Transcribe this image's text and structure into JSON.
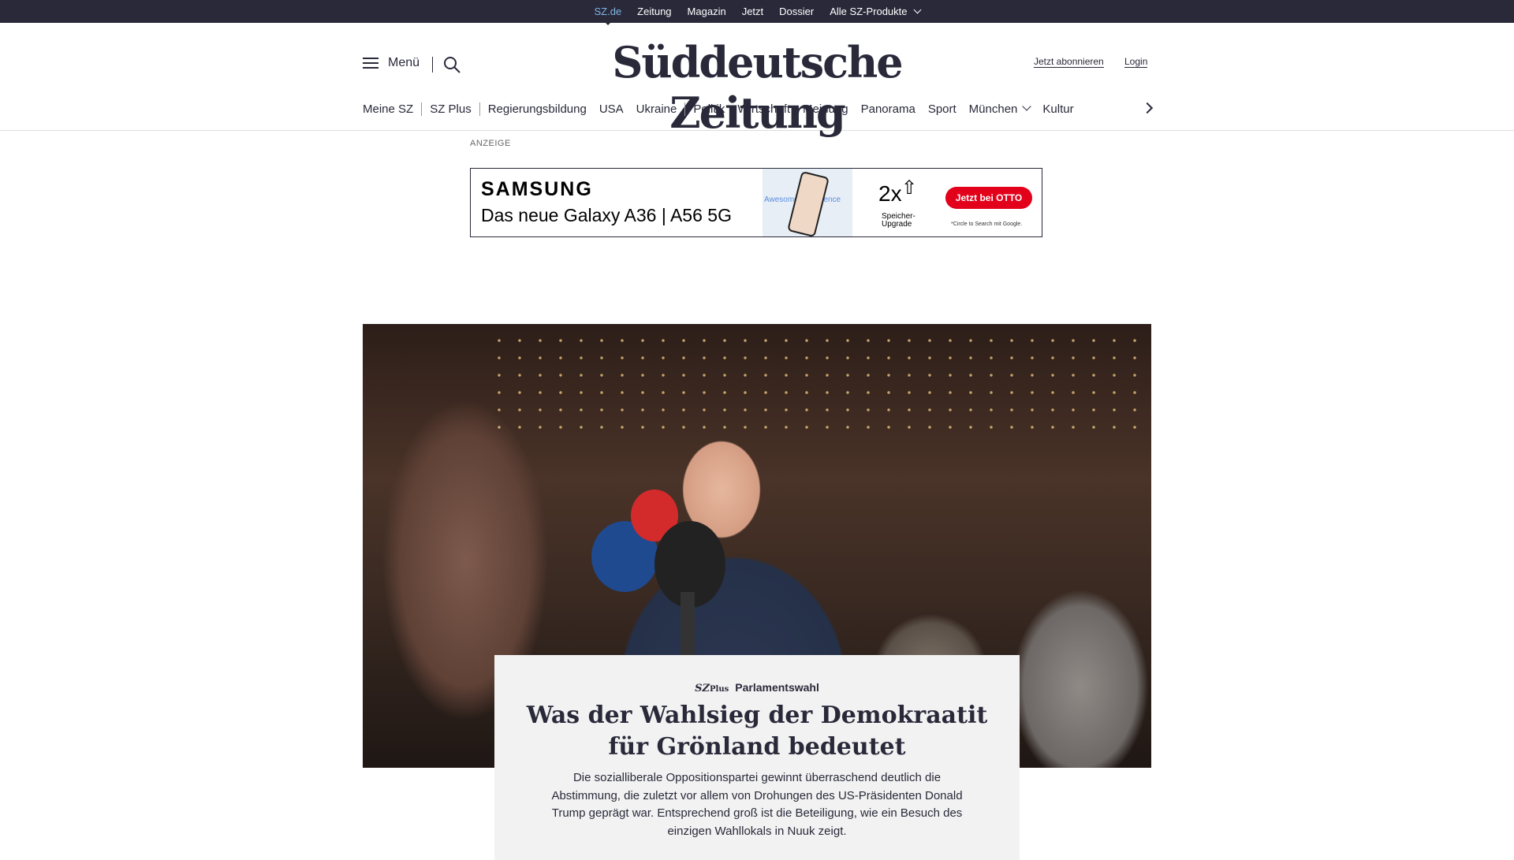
{
  "topbar": {
    "items": [
      "SZ.de",
      "Zeitung",
      "Magazin",
      "Jetzt",
      "Dossier",
      "Alle SZ-Produkte"
    ]
  },
  "header": {
    "menu_label": "Menü",
    "logo": "Süddeutsche Zeitung",
    "subscribe": "Jetzt abonnieren",
    "login": "Login"
  },
  "nav": {
    "items": [
      "Meine SZ",
      "SZ Plus",
      "Regierungsbildung",
      "USA",
      "Ukraine",
      "Politik",
      "Wirtschaft",
      "Meinung",
      "Panorama",
      "Sport",
      "München",
      "Kultur"
    ]
  },
  "ad": {
    "label": "ANZEIGE",
    "brand": "SAMSUNG",
    "headline": "Das neue Galaxy A36 | A56 5G",
    "awesome": "Awesome Intelligence",
    "storage_big": "2x",
    "storage_text": "Speicher-Upgrade",
    "cta": "Jetzt bei OTTO",
    "note": "*Circle to Search mit Google."
  },
  "article": {
    "badge_main": "SZ",
    "badge_sub": "Plus",
    "kicker": "Parlamentswahl",
    "title": "Was der Wahlsieg der Demokraatit für Grönland bedeutet",
    "teaser": "Die sozialliberale Oppositionspartei gewinnt überraschend deutlich die Abstimmung, die zuletzt vor allem von Drohungen des US-Präsidenten Donald Trump geprägt war. Entsprechend groß ist die Beteiligung, wie ein Besuch des einzigen Wahllokals in Nuuk zeigt."
  },
  "colors": {
    "topbar_bg": "#29293a",
    "active_link": "#7fb6e4",
    "text": "#29293a",
    "otto_red": "#e2001a",
    "card_bg": "#f2f2f2"
  }
}
